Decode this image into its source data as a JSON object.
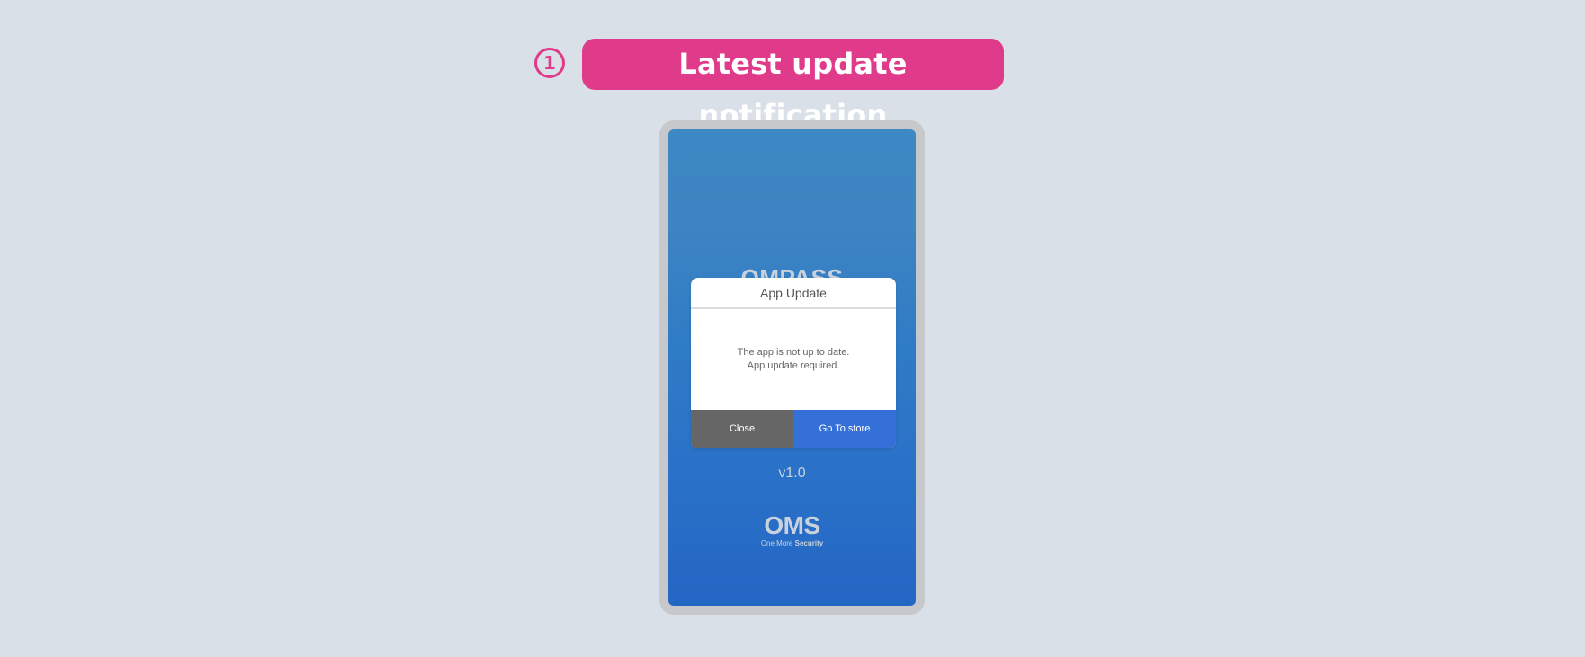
{
  "header": {
    "step_number": "1",
    "title": "Latest update notification",
    "accent_color": "#e03b8b"
  },
  "phone": {
    "app_name": "OMPASS",
    "version": "v1.0",
    "brand": {
      "logo": "OMS",
      "tagline_prefix": "One More ",
      "tagline_bold": "Security"
    },
    "dialog": {
      "title": "App Update",
      "message_line1": "The app is not up to date.",
      "message_line2": "App update required.",
      "close_label": "Close",
      "store_label": "Go To store"
    }
  },
  "colors": {
    "background": "#dae0e7",
    "screen_gradient_top": "#3d89c4",
    "screen_gradient_bottom": "#2466c4",
    "close_button": "#666666",
    "store_button": "#3470d8"
  }
}
